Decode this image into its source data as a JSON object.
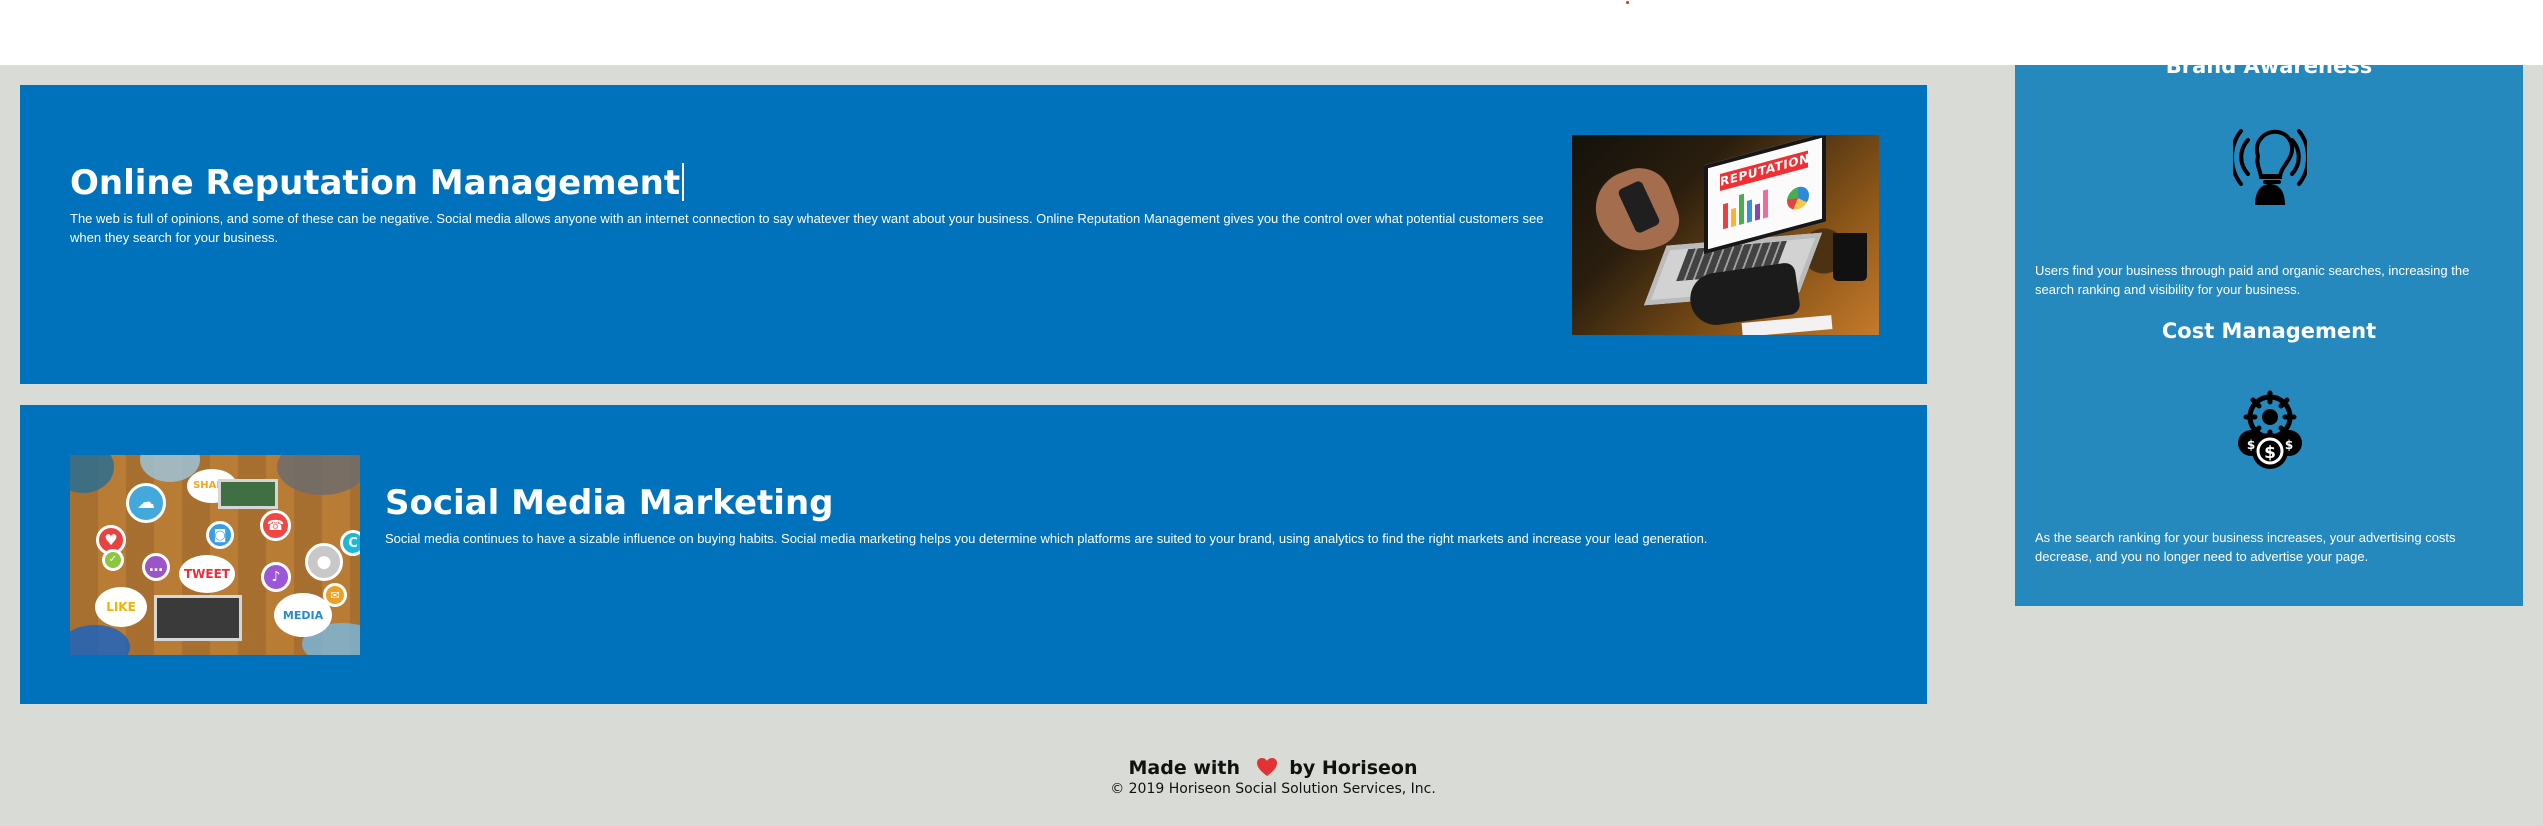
{
  "header": {
    "accent_color": "#d9322a"
  },
  "sections": {
    "reputation": {
      "title": "Online Reputation Management",
      "text": "The web is full of opinions, and some of these can be negative. Social media allows anyone with an internet connection to say whatever they want about your business. Online Reputation Management gives you the control over what potential customers see when they search for your business.",
      "image_text": "REPUTATION",
      "image_icon": "reputation-laptop-image"
    },
    "social": {
      "title": "Social Media Marketing",
      "text": "Social media continues to have a sizable influence on buying habits. Social media marketing helps you determine which platforms are suited to your brand, using analytics to find the right markets and increase your lead generation.",
      "image_icon": "social-media-collage-image",
      "bubbles": {
        "share": "SHARE",
        "tweet": "TWEET",
        "like": "LIKE",
        "media": "MEDIA"
      }
    }
  },
  "sidebar": {
    "brand": {
      "title": "Brand Awareness",
      "icon": "brand-awareness-icon",
      "text": "Users find your business through paid and organic searches, increasing the search ranking and visibility for your business."
    },
    "cost": {
      "title": "Cost Management",
      "icon": "cost-management-icon",
      "text": "As the search ranking for your business increases, your advertising costs decrease, and you no longer need to advertise your page."
    }
  },
  "footer": {
    "made_with": "Made with",
    "by_horiseon": "by Horiseon",
    "copyright": "© 2019 Horiseon Social Solution Services, Inc."
  },
  "colors": {
    "page_background": "#d9dcd6",
    "header_background": "#ffffff",
    "card_background": "#0072bb",
    "sidebar_background": "#2589bd",
    "heart": "#e33232"
  }
}
